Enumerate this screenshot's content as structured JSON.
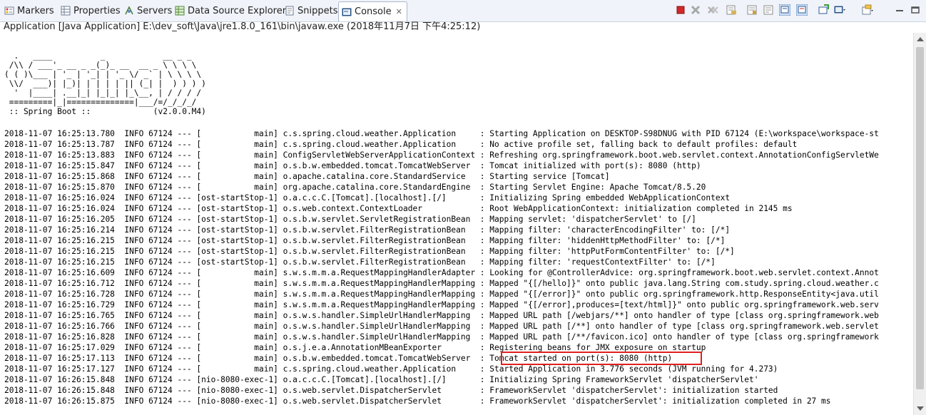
{
  "tabs": [
    {
      "label": "Markers",
      "icon": "markers-icon"
    },
    {
      "label": "Properties",
      "icon": "properties-icon"
    },
    {
      "label": "Servers",
      "icon": "servers-icon"
    },
    {
      "label": "Data Source Explorer",
      "icon": "data-source-icon"
    },
    {
      "label": "Snippets",
      "icon": "snippets-icon"
    },
    {
      "label": "Console",
      "icon": "console-icon",
      "active": true
    }
  ],
  "toolbar_icons": [
    "terminate-icon",
    "remove-launch-icon",
    "remove-all-terminated-icon",
    "clear-console-icon",
    "scroll-lock-icon",
    "word-wrap-icon",
    "show-console-on-output-icon",
    "show-console-on-error-icon",
    "pin-console-icon",
    "display-selected-console-icon",
    "open-console-icon",
    "minimize-icon",
    "maximize-icon"
  ],
  "console_description": "Application [Java Application] E:\\dev_soft\\Java\\jre1.8.0_161\\bin\\javaw.exe (2018年11月7日 下午4:25:12)",
  "console_lines": [
    "  .   ____          _            __ _ _",
    " /\\\\ / ___'_ __ _ _(_)_ __  __ _ \\ \\ \\ \\",
    "( ( )\\___ | '_ | '_| | '_ \\/ _` | \\ \\ \\ \\",
    " \\\\/  ___)| |_)| | | | | || (_| |  ) ) ) )",
    "  '  |____| .__|_| |_|_| |_\\__, | / / / /",
    " =========|_|==============|___/=/_/_/_/",
    " :: Spring Boot ::             (v2.0.0.M4)",
    "",
    "2018-11-07 16:25:13.780  INFO 67124 --- [           main] c.s.spring.cloud.weather.Application     : Starting Application on DESKTOP-S98DNUG with PID 67124 (E:\\workspace\\workspace-st",
    "2018-11-07 16:25:13.787  INFO 67124 --- [           main] c.s.spring.cloud.weather.Application     : No active profile set, falling back to default profiles: default",
    "2018-11-07 16:25:13.883  INFO 67124 --- [           main] ConfigServletWebServerApplicationContext : Refreshing org.springframework.boot.web.servlet.context.AnnotationConfigServletWe",
    "2018-11-07 16:25:15.847  INFO 67124 --- [           main] o.s.b.w.embedded.tomcat.TomcatWebServer  : Tomcat initialized with port(s): 8080 (http)",
    "2018-11-07 16:25:15.868  INFO 67124 --- [           main] o.apache.catalina.core.StandardService   : Starting service [Tomcat]",
    "2018-11-07 16:25:15.870  INFO 67124 --- [           main] org.apache.catalina.core.StandardEngine  : Starting Servlet Engine: Apache Tomcat/8.5.20",
    "2018-11-07 16:25:16.024  INFO 67124 --- [ost-startStop-1] o.a.c.c.C.[Tomcat].[localhost].[/]       : Initializing Spring embedded WebApplicationContext",
    "2018-11-07 16:25:16.024  INFO 67124 --- [ost-startStop-1] o.s.web.context.ContextLoader            : Root WebApplicationContext: initialization completed in 2145 ms",
    "2018-11-07 16:25:16.205  INFO 67124 --- [ost-startStop-1] o.s.b.w.servlet.ServletRegistrationBean  : Mapping servlet: 'dispatcherServlet' to [/]",
    "2018-11-07 16:25:16.214  INFO 67124 --- [ost-startStop-1] o.s.b.w.servlet.FilterRegistrationBean   : Mapping filter: 'characterEncodingFilter' to: [/*]",
    "2018-11-07 16:25:16.215  INFO 67124 --- [ost-startStop-1] o.s.b.w.servlet.FilterRegistrationBean   : Mapping filter: 'hiddenHttpMethodFilter' to: [/*]",
    "2018-11-07 16:25:16.215  INFO 67124 --- [ost-startStop-1] o.s.b.w.servlet.FilterRegistrationBean   : Mapping filter: 'httpPutFormContentFilter' to: [/*]",
    "2018-11-07 16:25:16.215  INFO 67124 --- [ost-startStop-1] o.s.b.w.servlet.FilterRegistrationBean   : Mapping filter: 'requestContextFilter' to: [/*]",
    "2018-11-07 16:25:16.609  INFO 67124 --- [           main] s.w.s.m.m.a.RequestMappingHandlerAdapter : Looking for @ControllerAdvice: org.springframework.boot.web.servlet.context.Annot",
    "2018-11-07 16:25:16.712  INFO 67124 --- [           main] s.w.s.m.m.a.RequestMappingHandlerMapping : Mapped \"{[/hello]}\" onto public java.lang.String com.study.spring.cloud.weather.c",
    "2018-11-07 16:25:16.728  INFO 67124 --- [           main] s.w.s.m.m.a.RequestMappingHandlerMapping : Mapped \"{[/error]}\" onto public org.springframework.http.ResponseEntity<java.util",
    "2018-11-07 16:25:16.729  INFO 67124 --- [           main] s.w.s.m.m.a.RequestMappingHandlerMapping : Mapped \"{[/error],produces=[text/html]}\" onto public org.springframework.web.serv",
    "2018-11-07 16:25:16.765  INFO 67124 --- [           main] o.s.w.s.handler.SimpleUrlHandlerMapping  : Mapped URL path [/webjars/**] onto handler of type [class org.springframework.web",
    "2018-11-07 16:25:16.766  INFO 67124 --- [           main] o.s.w.s.handler.SimpleUrlHandlerMapping  : Mapped URL path [/**] onto handler of type [class org.springframework.web.servlet",
    "2018-11-07 16:25:16.828  INFO 67124 --- [           main] o.s.w.s.handler.SimpleUrlHandlerMapping  : Mapped URL path [/**/favicon.ico] onto handler of type [class org.springframework",
    "2018-11-07 16:25:17.029  INFO 67124 --- [           main] o.s.j.e.a.AnnotationMBeanExporter        : Registering beans for JMX exposure on startup",
    "2018-11-07 16:25:17.113  INFO 67124 --- [           main] o.s.b.w.embedded.tomcat.TomcatWebServer  : Tomcat started on port(s): 8080 (http)",
    "2018-11-07 16:25:17.127  INFO 67124 --- [           main] c.s.spring.cloud.weather.Application     : Started Application in 3.776 seconds (JVM running for 4.273)",
    "2018-11-07 16:26:15.848  INFO 67124 --- [nio-8080-exec-1] o.a.c.c.C.[Tomcat].[localhost].[/]       : Initializing Spring FrameworkServlet 'dispatcherServlet'",
    "2018-11-07 16:26:15.848  INFO 67124 --- [nio-8080-exec-1] o.s.web.servlet.DispatcherServlet        : FrameworkServlet 'dispatcherServlet': initialization started",
    "2018-11-07 16:26:15.875  INFO 67124 --- [nio-8080-exec-1] o.s.web.servlet.DispatcherServlet        : FrameworkServlet 'dispatcherServlet': initialization completed in 27 ms"
  ],
  "highlight_color": "#e02020"
}
